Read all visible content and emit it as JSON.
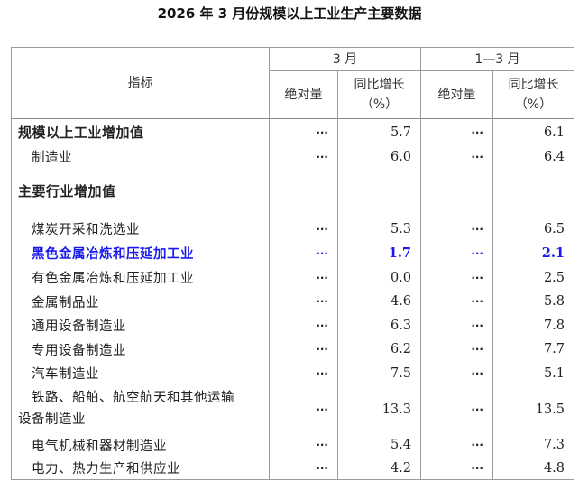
{
  "title": "2026 年 3 月份规模以上工业生产主要数据",
  "header": {
    "indicator": "指标",
    "period_march": "3 月",
    "period_q1": "1—3 月",
    "absolute": "绝对量",
    "yoy_line1": "同比增长",
    "yoy_line2": "（%）"
  },
  "rows": [
    {
      "label": "规模以上工业增加值",
      "abs_m": "···",
      "yoy_m": "5.7",
      "abs_q": "···",
      "yoy_q": "6.1"
    },
    {
      "label": "制造业",
      "abs_m": "···",
      "yoy_m": "6.0",
      "abs_q": "···",
      "yoy_q": "6.4"
    },
    {
      "label": "主要行业增加值"
    },
    {
      "label": "煤炭开采和洗选业",
      "abs_m": "···",
      "yoy_m": "5.3",
      "abs_q": "···",
      "yoy_q": "6.5"
    },
    {
      "label": "黑色金属冶炼和压延加工业",
      "abs_m": "···",
      "yoy_m": "1.7",
      "abs_q": "···",
      "yoy_q": "2.1"
    },
    {
      "label": "有色金属冶炼和压延加工业",
      "abs_m": "···",
      "yoy_m": "0.0",
      "abs_q": "···",
      "yoy_q": "2.5"
    },
    {
      "label": "金属制品业",
      "abs_m": "···",
      "yoy_m": "4.6",
      "abs_q": "···",
      "yoy_q": "5.8"
    },
    {
      "label": "通用设备制造业",
      "abs_m": "···",
      "yoy_m": "6.3",
      "abs_q": "···",
      "yoy_q": "7.8"
    },
    {
      "label": "专用设备制造业",
      "abs_m": "···",
      "yoy_m": "6.2",
      "abs_q": "···",
      "yoy_q": "7.7"
    },
    {
      "label": "汽车制造业",
      "abs_m": "···",
      "yoy_m": "7.5",
      "abs_q": "···",
      "yoy_q": "5.1"
    },
    {
      "label_line1": "铁路、船舶、航空航天和其他运输",
      "label_line2": "设备制造业",
      "abs_m": "···",
      "yoy_m": "13.3",
      "abs_q": "···",
      "yoy_q": "13.5"
    },
    {
      "label": "电气机械和器材制造业",
      "abs_m": "···",
      "yoy_m": "5.4",
      "abs_q": "···",
      "yoy_q": "7.3"
    },
    {
      "label": "电力、热力生产和供应业",
      "abs_m": "···",
      "yoy_m": "4.2",
      "abs_q": "···",
      "yoy_q": "4.8"
    }
  ],
  "highlight_color": "#1a1aee"
}
